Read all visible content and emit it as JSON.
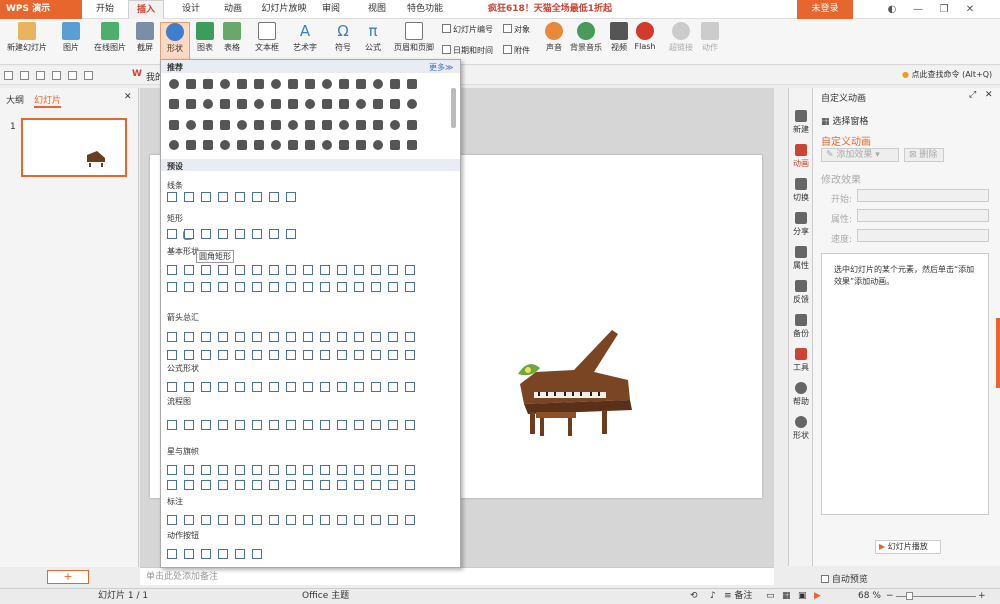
{
  "app": {
    "logo": "WPS 演示",
    "promo": "疯狂618！天猫全场最低1折起",
    "login": "未登录"
  },
  "menu_tabs": [
    "开始",
    "插入",
    "设计",
    "动画",
    "幻灯片放映",
    "审阅",
    "视图",
    "特色功能"
  ],
  "ribbon": {
    "new_slide": "新建幻灯片",
    "picture": "图片",
    "online_picture": "在线图片",
    "screenshot": "截屏",
    "shape": "形状",
    "chart": "图表",
    "table": "表格",
    "textbox": "文本框",
    "wordart": "艺术字",
    "symbol": "符号",
    "formula": "公式",
    "header_footer": "页眉和页脚",
    "slide_number": "幻灯片编号",
    "object": "对象",
    "datetime": "日期和时间",
    "attachment": "附件",
    "audio": "声音",
    "bgmusic": "背景音乐",
    "video": "视频",
    "flash": "Flash",
    "hyperlink": "超链接",
    "action": "动作"
  },
  "quickbar": {
    "mine": "我的",
    "search": "点此查找命令",
    "shortcut": "(Alt+Q)"
  },
  "leftpanel": {
    "tab_outline": "大纲",
    "tab_slides": "幻灯片",
    "slide_index": "1"
  },
  "gallery": {
    "recommended": "推荐",
    "more": "更多≫",
    "preset": "预设",
    "lines": "线条",
    "rectangles": "矩形",
    "basic": "基本形状",
    "arrows": "箭头总汇",
    "equation": "公式形状",
    "flowchart": "流程图",
    "stars": "星与旗帜",
    "callouts": "标注",
    "action_buttons": "动作按钮"
  },
  "tooltip": "圆角矩形",
  "note_placeholder": "单击此处添加备注",
  "vtools": [
    "新建",
    "动画",
    "切换",
    "分享",
    "属性",
    "反馈",
    "备份",
    "工具",
    "帮助",
    "形状"
  ],
  "pane": {
    "title": "自定义动画",
    "select_pane": "选择窗格",
    "section": "自定义动画",
    "add_effect": "添加效果",
    "delete": "删除",
    "modify": "修改效果",
    "start": "开始:",
    "property": "属性:",
    "speed": "速度:",
    "hint": "选中幻灯片的某个元素，然后单击“添加效果”添加动画。",
    "play": "幻灯片播放",
    "autopreview": "自动预览"
  },
  "status": {
    "slide": "幻灯片 1 / 1",
    "theme": "Office 主题",
    "notes": "备注",
    "zoom": "68 %"
  }
}
